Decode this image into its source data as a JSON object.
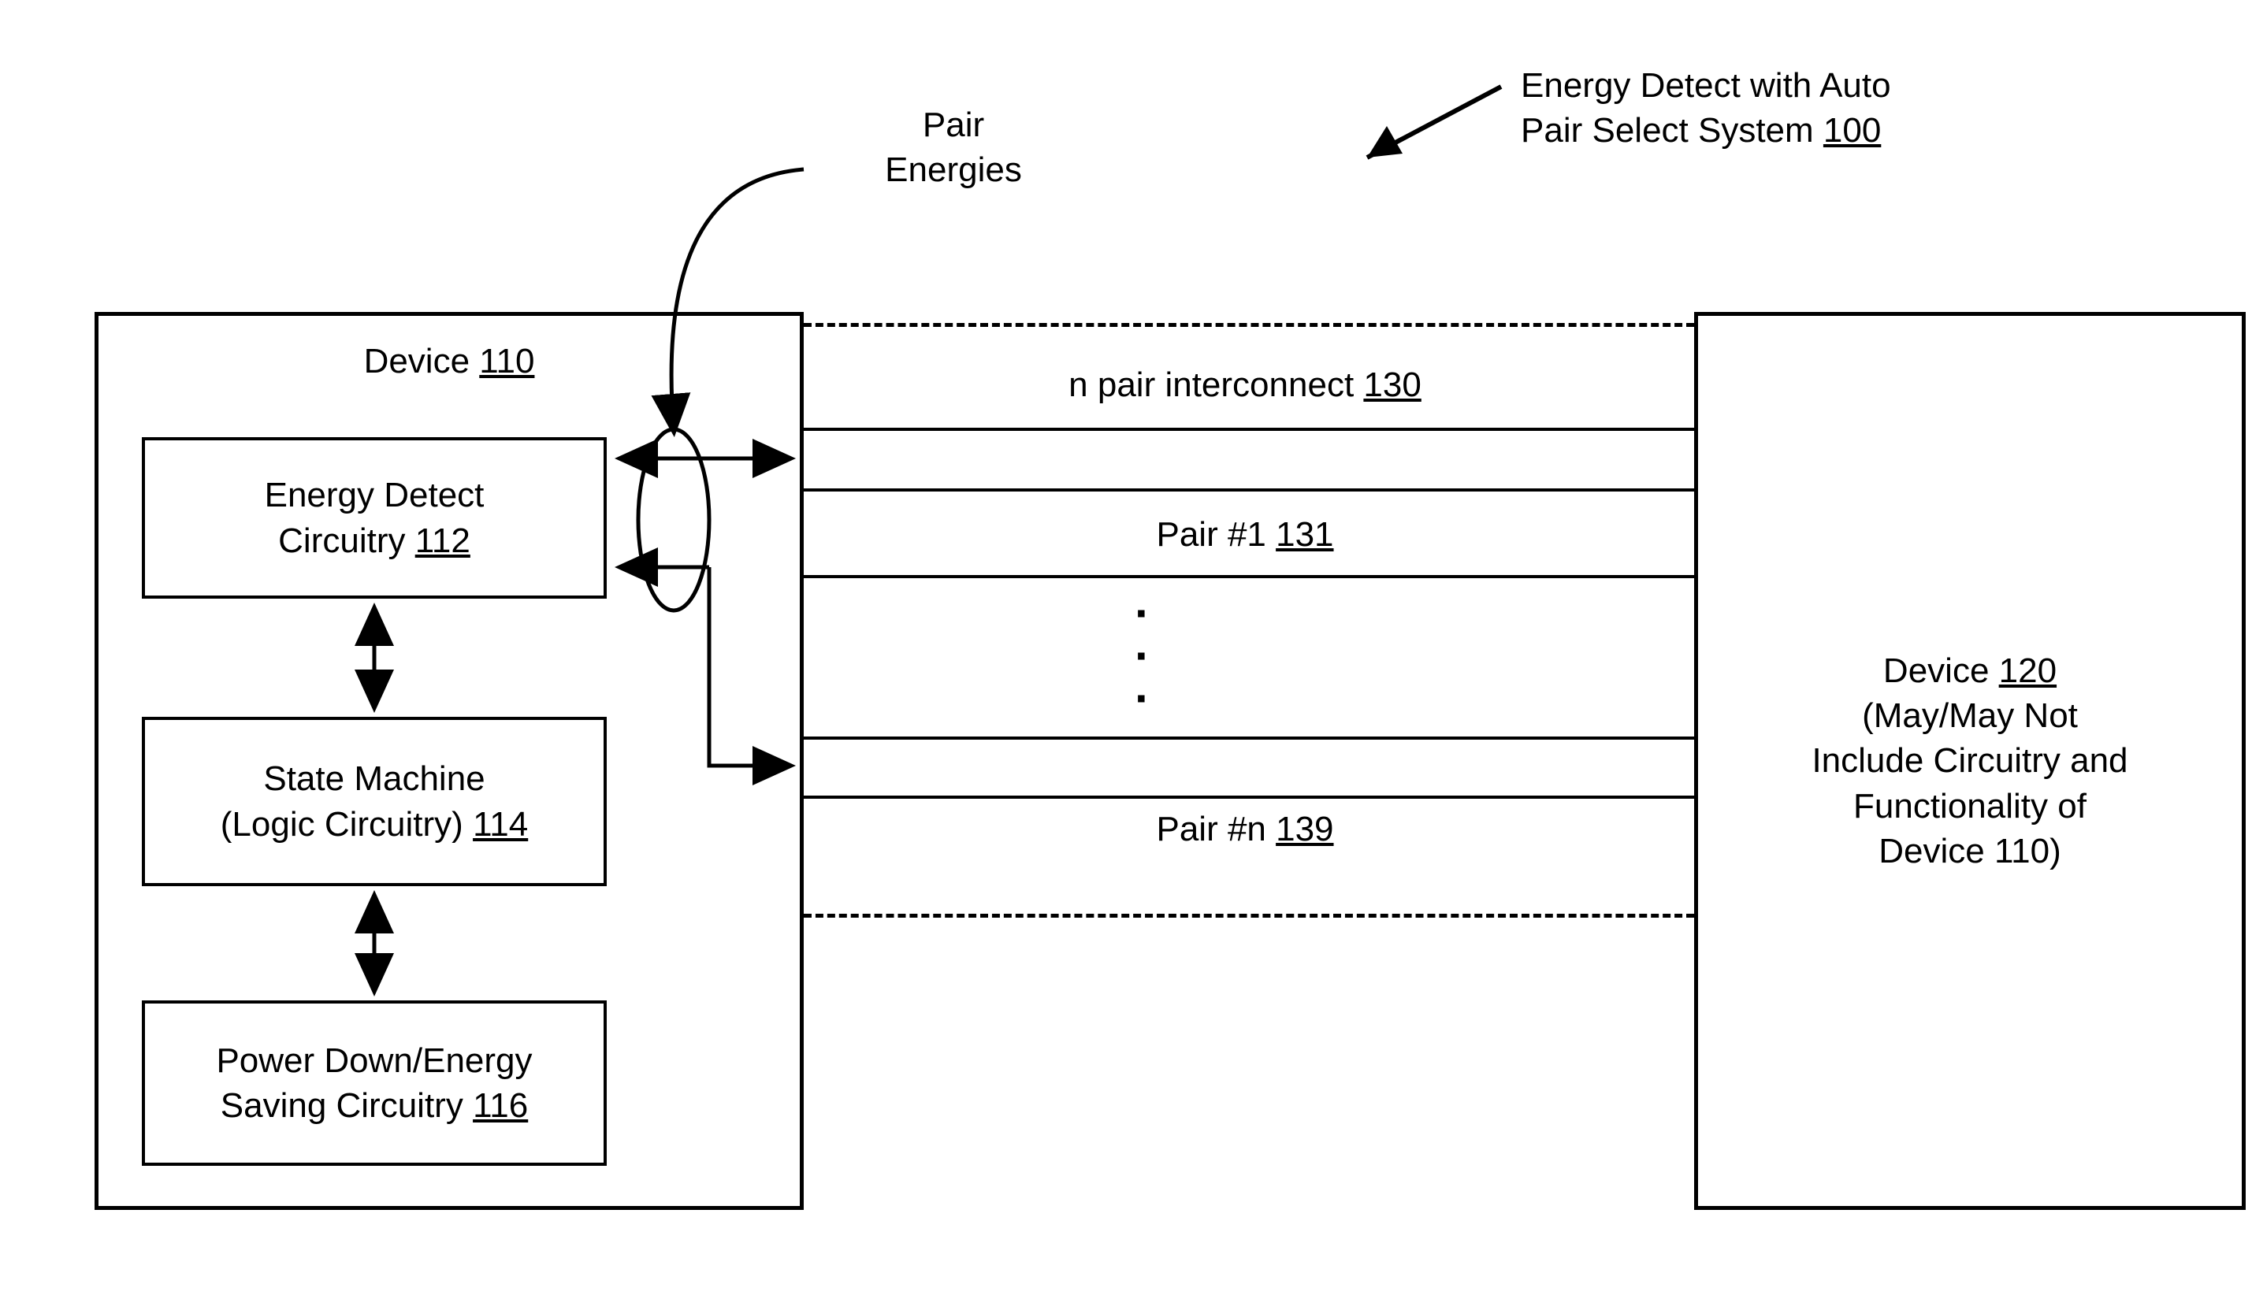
{
  "title": {
    "line1": "Energy Detect with Auto",
    "line2a": "Pair Select System ",
    "line2b": "100"
  },
  "pair_energies": {
    "line1": "Pair",
    "line2": "Energies"
  },
  "device110": {
    "title_prefix": "Device ",
    "title_num": "110",
    "energy_detect_line1": "Energy Detect",
    "energy_detect_line2a": "Circuitry ",
    "energy_detect_line2b": "112",
    "state_machine_line1": "State Machine",
    "state_machine_line2a": "(Logic Circuitry) ",
    "state_machine_line2b": "114",
    "power_down_line1": "Power Down/Energy",
    "power_down_line2a": "Saving Circuitry ",
    "power_down_line2b": "116"
  },
  "interconnect": {
    "title_a": "n pair interconnect ",
    "title_b": "130",
    "pair1_a": "Pair #1 ",
    "pair1_b": "131",
    "pairn_a": "Pair #n ",
    "pairn_b": "139"
  },
  "device120": {
    "line1a": "Device ",
    "line1b": "120",
    "line2": "(May/May Not",
    "line3": "Include Circuitry and",
    "line4": "Functionality of",
    "line5": "Device 110)"
  }
}
